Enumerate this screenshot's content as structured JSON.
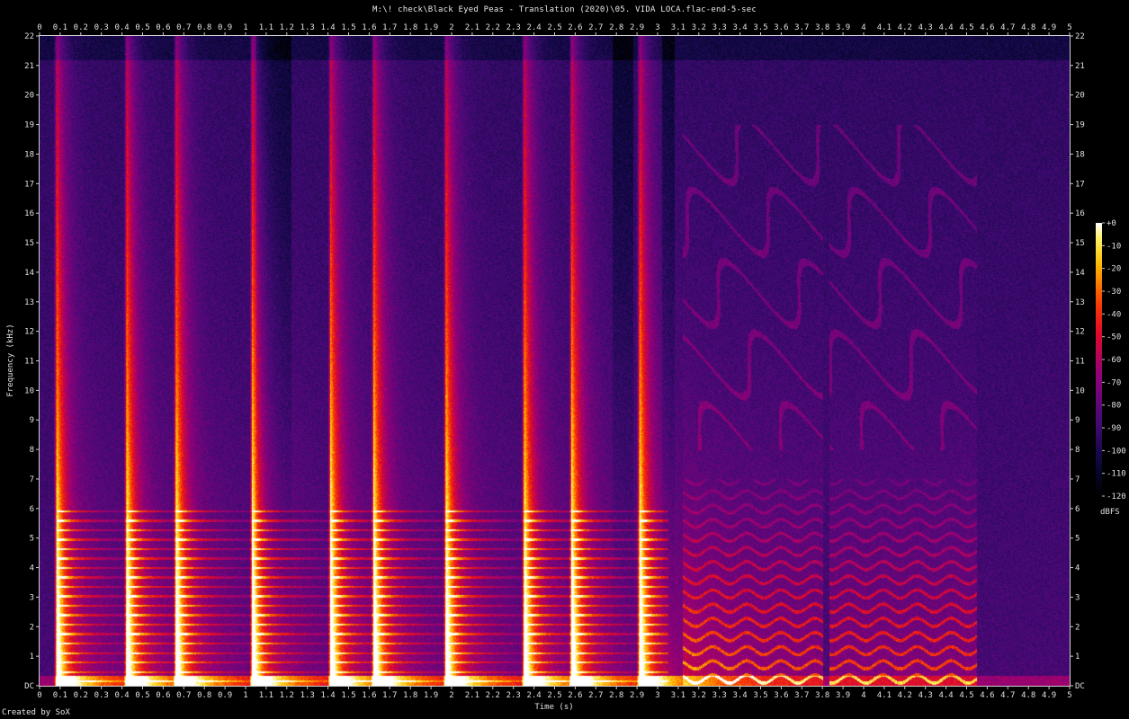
{
  "title": "M:\\! check\\Black Eyed Peas - Translation (2020)\\05. VIDA LOCA.flac-end-5-sec",
  "credit": "Created by SoX",
  "chart_data": {
    "type": "heatmap",
    "xlabel": "Time (s)",
    "ylabel": "Frequency (kHz)",
    "xlim": [
      0,
      5
    ],
    "ylim": [
      0,
      22
    ],
    "x_ticks": [
      "0",
      "0.1",
      "0.2",
      "0.3",
      "0.4",
      "0.5",
      "0.6",
      "0.7",
      "0.8",
      "0.9",
      "1",
      "1.1",
      "1.2",
      "1.3",
      "1.4",
      "1.5",
      "1.6",
      "1.7",
      "1.8",
      "1.9",
      "2",
      "2.1",
      "2.2",
      "2.3",
      "2.4",
      "2.5",
      "2.6",
      "2.7",
      "2.8",
      "2.9",
      "3",
      "3.1",
      "3.2",
      "3.3",
      "3.4",
      "3.5",
      "3.6",
      "3.7",
      "3.8",
      "3.9",
      "4",
      "4.1",
      "4.2",
      "4.3",
      "4.4",
      "4.5",
      "4.6",
      "4.7",
      "4.8",
      "4.9",
      "5"
    ],
    "y_ticks": [
      "DC",
      "1",
      "2",
      "3",
      "4",
      "5",
      "6",
      "7",
      "8",
      "9",
      "10",
      "11",
      "12",
      "13",
      "14",
      "15",
      "16",
      "17",
      "18",
      "19",
      "20",
      "21",
      "22"
    ],
    "colorbar": {
      "label": "dBFS",
      "ticks": [
        "0",
        "-10",
        "-20",
        "-30",
        "-40",
        "-50",
        "-60",
        "-70",
        "-80",
        "-90",
        "-100",
        "-110",
        "-120"
      ],
      "range": [
        -120,
        0
      ]
    },
    "transients_s": [
      0.08,
      0.42,
      0.66,
      1.03,
      1.41,
      1.62,
      1.97,
      2.35,
      2.58,
      2.91
    ],
    "events": [
      {
        "label": "sustained tonal section",
        "start_s": 3.12,
        "end_s": 3.8
      },
      {
        "label": "sustained tonal section",
        "start_s": 3.83,
        "end_s": 4.55
      }
    ]
  }
}
